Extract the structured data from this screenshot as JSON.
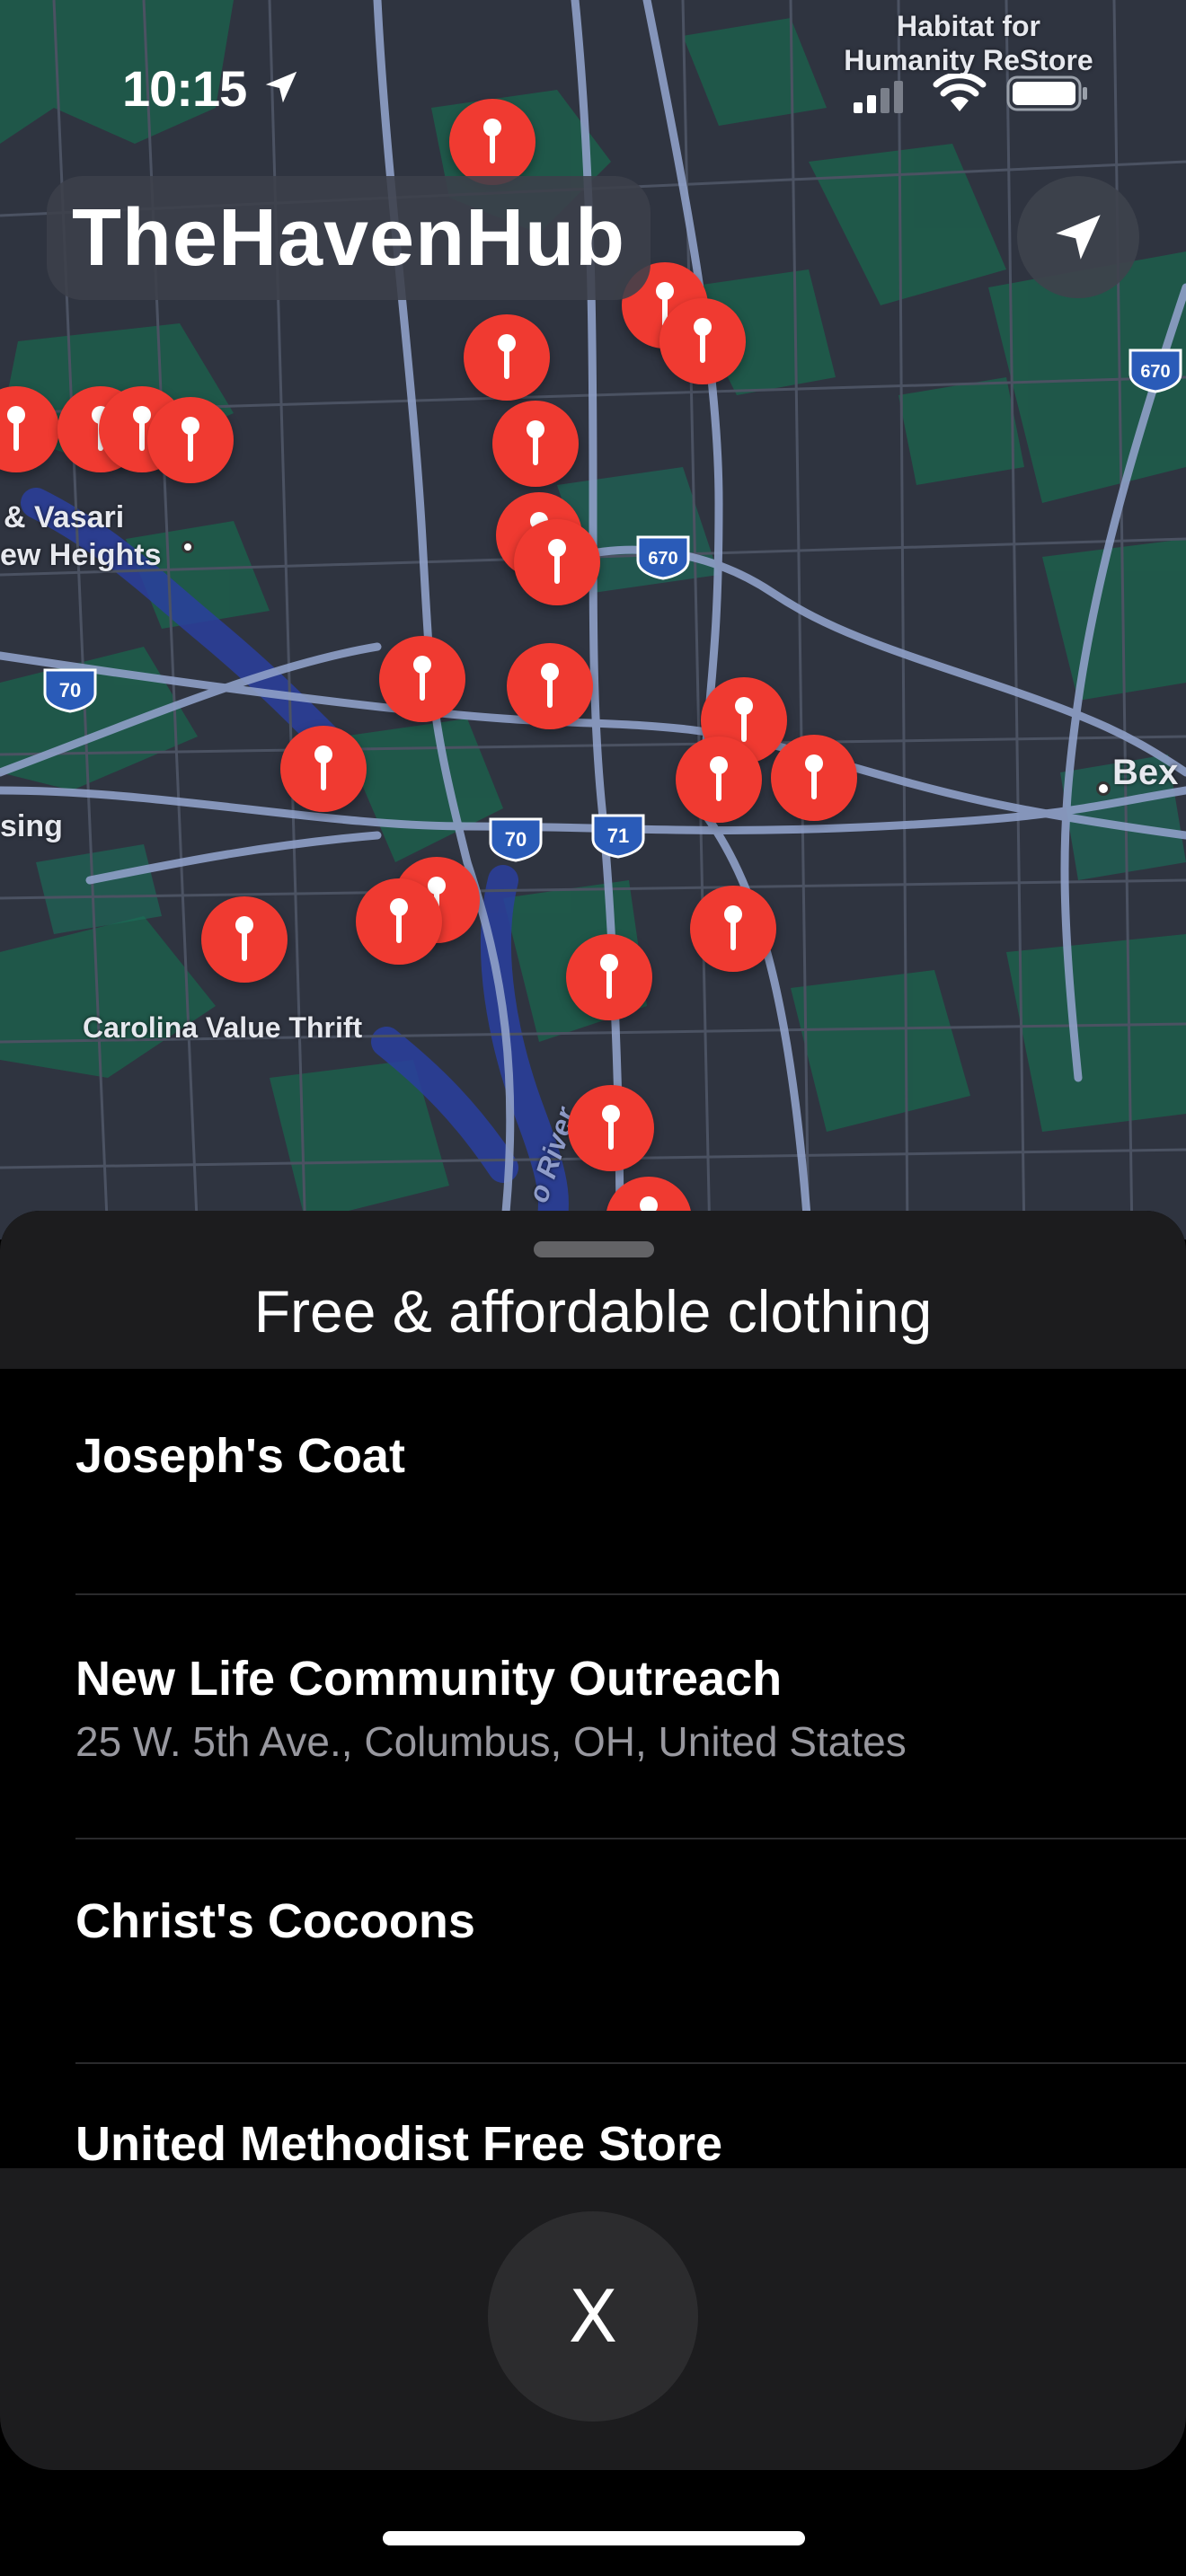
{
  "status_bar": {
    "time": "10:15",
    "location_arrow_icon": "location-arrow-icon",
    "signal_icon": "cellular-signal-icon",
    "wifi_icon": "wifi-icon",
    "battery_icon": "battery-icon"
  },
  "app": {
    "title": "TheHavenHub",
    "locate_icon": "location-arrow-icon"
  },
  "map": {
    "labels": {
      "habitat": "Habitat for\nHumanity ReStore",
      "vasari": "& Vasari",
      "heights": "ew Heights",
      "lansing": "sing",
      "bexley": "Bex",
      "carolina": "Carolina Value Thrift",
      "river": "o River"
    },
    "shields": [
      "670",
      "670",
      "70",
      "70",
      "71"
    ],
    "pin_icon": "map-pin-icon",
    "pin_color": "#f03a31"
  },
  "sheet": {
    "title": "Free & affordable clothing",
    "items": [
      {
        "name": "Joseph's Coat",
        "address": ""
      },
      {
        "name": "New Life Community Outreach",
        "address": "25 W. 5th Ave., Columbus, OH, United States"
      },
      {
        "name": "Christ's Cocoons",
        "address": ""
      },
      {
        "name": "United Methodist Free Store",
        "address": ""
      }
    ],
    "close_label": "X"
  },
  "colors": {
    "accent_pin": "#f03a31",
    "sheet_bg": "#1c1c1e",
    "list_bg": "#000000",
    "secondary_text": "#98989f"
  }
}
